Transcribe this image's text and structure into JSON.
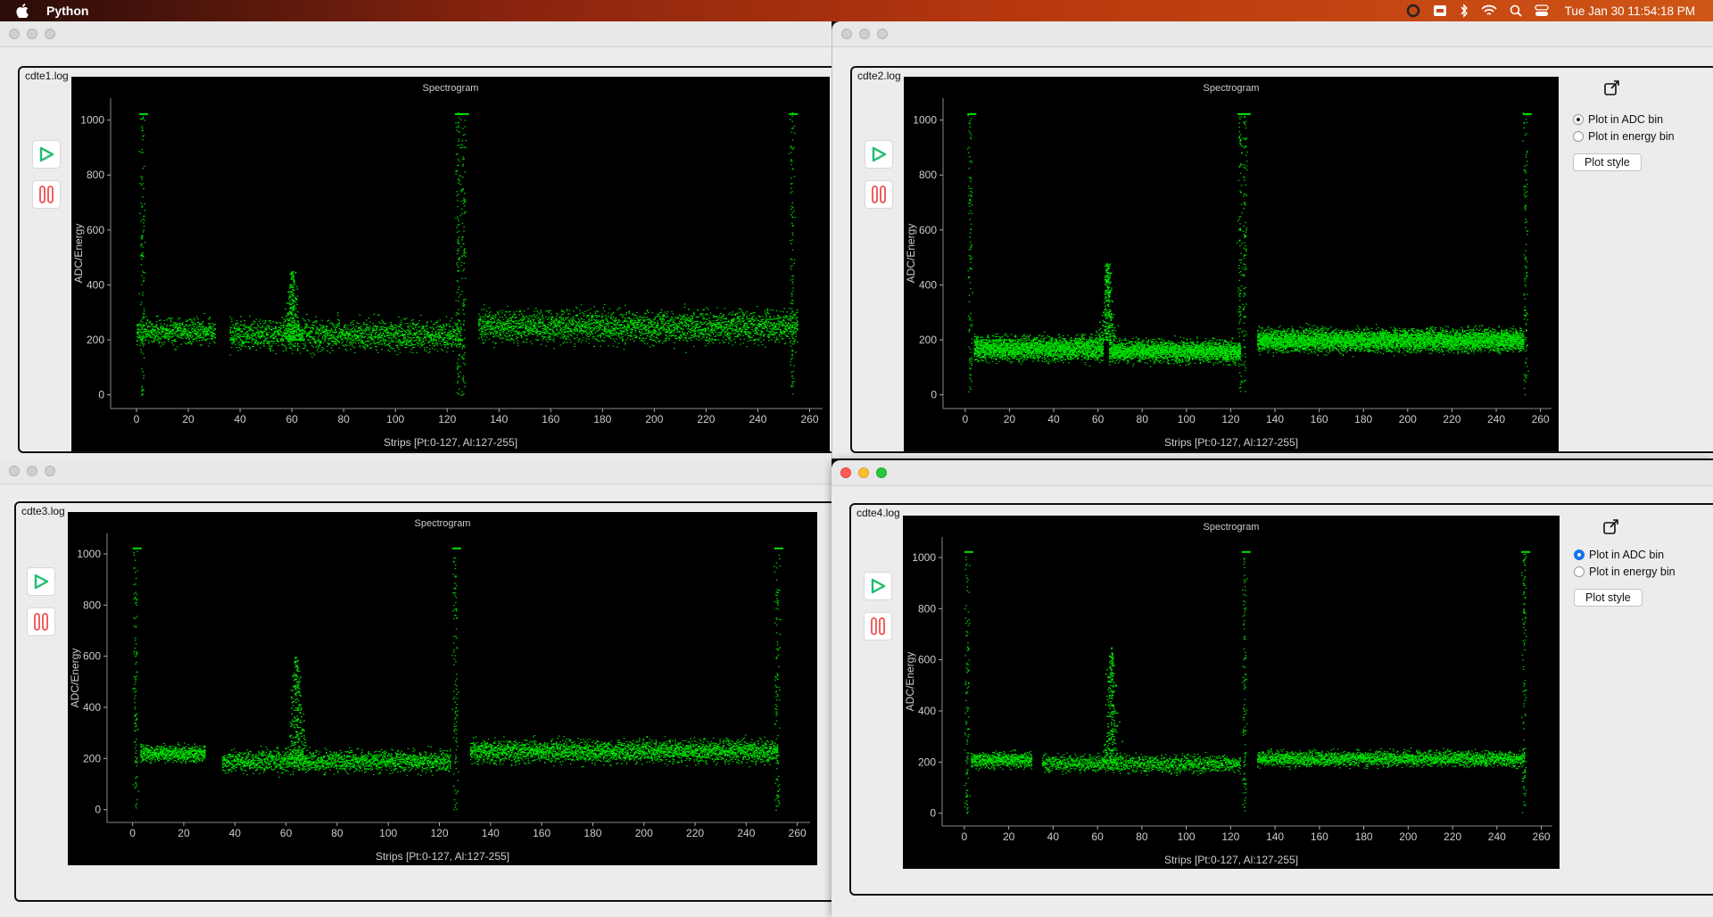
{
  "menubar": {
    "app_name": "Python",
    "clock": "Tue Jan 30  11:54:18 PM"
  },
  "common": {
    "plot_title": "Spectrogram",
    "xlabel": "Strips [Pt:0-127, Al:127-255]",
    "ylabel": "ADC/Energy",
    "radio_adc": "Plot in ADC bin",
    "radio_energy": "Plot in energy bin",
    "plot_style": "Plot style"
  },
  "windows": [
    {
      "file": "cdte1.log",
      "show_side_panel": false,
      "active": false
    },
    {
      "file": "cdte2.log",
      "show_side_panel": true,
      "active": false,
      "adc_selected": true
    },
    {
      "file": "cdte3.log",
      "show_side_panel": false,
      "active": false
    },
    {
      "file": "cdte4.log",
      "show_side_panel": true,
      "active": true,
      "adc_selected": true
    }
  ],
  "chart_data": [
    {
      "type": "heatmap",
      "title": "Spectrogram",
      "xlabel": "Strips [Pt:0-127, Al:127-255]",
      "ylabel": "ADC/Energy",
      "xlim": [
        -10,
        265
      ],
      "ylim": [
        -50,
        1080
      ],
      "xticks": [
        0,
        20,
        40,
        60,
        80,
        100,
        120,
        140,
        160,
        180,
        200,
        220,
        240,
        260
      ],
      "yticks": [
        0,
        200,
        400,
        600,
        800,
        1000
      ],
      "color": "#00e000",
      "bands": [
        {
          "x_range": [
            0,
            30
          ],
          "y_center": 230,
          "spread": 45,
          "density": 0.45
        },
        {
          "x_range": [
            36,
            125
          ],
          "y_center": 220,
          "spread": 50,
          "density": 0.45
        },
        {
          "x_range": [
            132,
            255
          ],
          "y_center": 250,
          "spread": 55,
          "density": 0.5
        }
      ],
      "peaks": [
        {
          "x": 60,
          "y_top": 300
        }
      ],
      "columns": [
        2,
        124,
        126,
        253
      ]
    },
    {
      "type": "heatmap",
      "title": "Spectrogram",
      "xlabel": "Strips [Pt:0-127, Al:127-255]",
      "ylabel": "ADC/Energy",
      "xlim": [
        -10,
        265
      ],
      "ylim": [
        -50,
        1080
      ],
      "xticks": [
        0,
        20,
        40,
        60,
        80,
        100,
        120,
        140,
        160,
        180,
        200,
        220,
        240,
        260
      ],
      "yticks": [
        0,
        200,
        400,
        600,
        800,
        1000
      ],
      "color": "#00e000",
      "bands": [
        {
          "x_range": [
            4,
            62
          ],
          "y_center": 170,
          "spread": 40,
          "density": 0.9
        },
        {
          "x_range": [
            65,
            124
          ],
          "y_center": 160,
          "spread": 35,
          "density": 0.9
        },
        {
          "x_range": [
            132,
            252
          ],
          "y_center": 200,
          "spread": 38,
          "density": 0.95
        }
      ],
      "peaks": [
        {
          "x": 64,
          "y_top": 330
        }
      ],
      "columns": [
        2,
        124,
        126,
        253
      ]
    },
    {
      "type": "heatmap",
      "title": "Spectrogram",
      "xlabel": "Strips [Pt:0-127, Al:127-255]",
      "ylabel": "ADC/Energy",
      "xlim": [
        -10,
        265
      ],
      "ylim": [
        -50,
        1080
      ],
      "xticks": [
        0,
        20,
        40,
        60,
        80,
        100,
        120,
        140,
        160,
        180,
        200,
        220,
        240,
        260
      ],
      "yticks": [
        0,
        200,
        400,
        600,
        800,
        1000
      ],
      "color": "#00e000",
      "bands": [
        {
          "x_range": [
            3,
            28
          ],
          "y_center": 220,
          "spread": 30,
          "density": 0.6
        },
        {
          "x_range": [
            35,
            124
          ],
          "y_center": 190,
          "spread": 40,
          "density": 0.45
        },
        {
          "x_range": [
            132,
            252
          ],
          "y_center": 230,
          "spread": 40,
          "density": 0.55
        }
      ],
      "peaks": [
        {
          "x": 64,
          "y_top": 450
        }
      ],
      "columns": [
        1,
        126,
        252
      ]
    },
    {
      "type": "heatmap",
      "title": "Spectrogram",
      "xlabel": "Strips [Pt:0-127, Al:127-255]",
      "ylabel": "ADC/Energy",
      "xlim": [
        -10,
        265
      ],
      "ylim": [
        -50,
        1080
      ],
      "xticks": [
        0,
        20,
        40,
        60,
        80,
        100,
        120,
        140,
        160,
        180,
        200,
        220,
        240,
        260
      ],
      "yticks": [
        0,
        200,
        400,
        600,
        800,
        1000
      ],
      "color": "#00e000",
      "bands": [
        {
          "x_range": [
            3,
            30
          ],
          "y_center": 210,
          "spread": 28,
          "density": 0.5
        },
        {
          "x_range": [
            35,
            124
          ],
          "y_center": 195,
          "spread": 30,
          "density": 0.35
        },
        {
          "x_range": [
            132,
            252
          ],
          "y_center": 215,
          "spread": 28,
          "density": 0.45
        }
      ],
      "peaks": [
        {
          "x": 66,
          "y_top": 500
        }
      ],
      "columns": [
        1,
        126,
        252
      ]
    }
  ]
}
